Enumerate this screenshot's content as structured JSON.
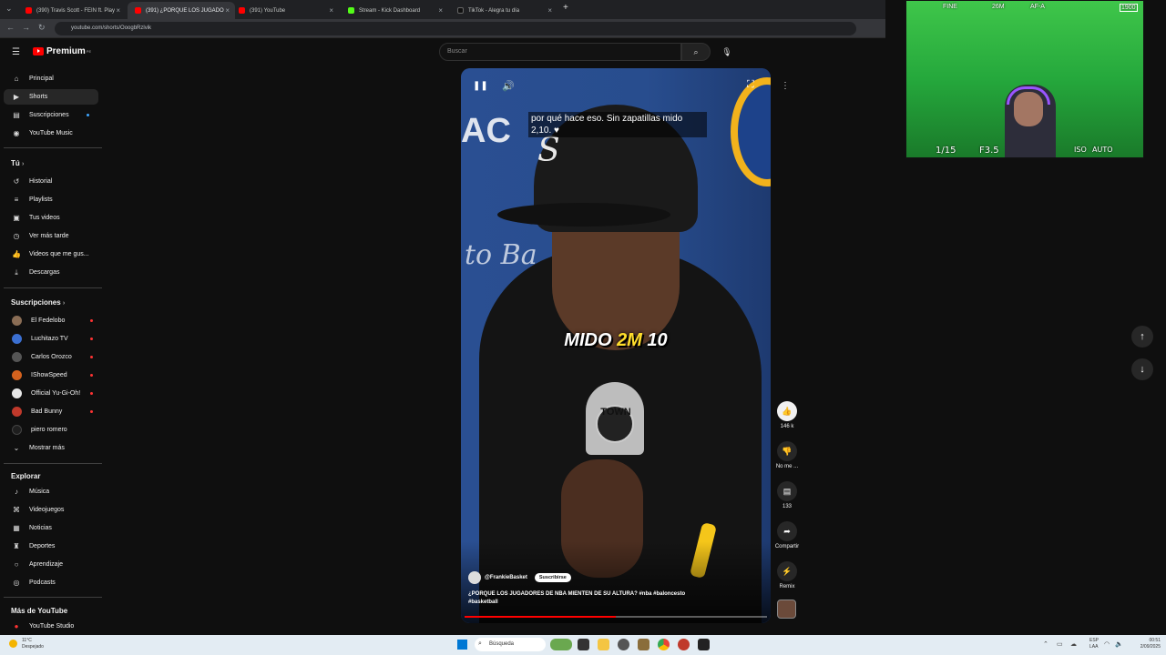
{
  "browser": {
    "tabs": [
      {
        "title": "(390) Travis Scott - FEIN ft. Play",
        "color": "#ff0000"
      },
      {
        "title": "(391) ¿PORQUE LOS JUGADO",
        "color": "#ff0000"
      },
      {
        "title": "(391) YouTube",
        "color": "#ff0000"
      },
      {
        "title": "Stream - Kick Dashboard",
        "color": "#53fc18"
      },
      {
        "title": "TikTok - Alegra tu día",
        "color": "#111111"
      }
    ],
    "url": "youtube.com/shorts/OoogbRzlvik"
  },
  "header": {
    "logo": "Premium",
    "logo_super": "PE",
    "search_placeholder": "Buscar"
  },
  "sidebar": {
    "main": [
      {
        "label": "Principal",
        "icon": "home-icon"
      },
      {
        "label": "Shorts",
        "icon": "shorts-icon"
      },
      {
        "label": "Suscripciones",
        "icon": "subscriptions-icon"
      },
      {
        "label": "YouTube Music",
        "icon": "music-icon"
      }
    ],
    "you_title": "Tú",
    "you": [
      {
        "label": "Historial",
        "icon": "history-icon"
      },
      {
        "label": "Playlists",
        "icon": "playlists-icon"
      },
      {
        "label": "Tus videos",
        "icon": "your-videos-icon"
      },
      {
        "label": "Ver más tarde",
        "icon": "watch-later-icon"
      },
      {
        "label": "Videos que me gus...",
        "icon": "liked-icon"
      },
      {
        "label": "Descargas",
        "icon": "downloads-icon"
      }
    ],
    "subs_title": "Suscripciones",
    "subs": [
      {
        "label": "El Fedelobo",
        "color": "#8a6d55"
      },
      {
        "label": "Luchitazo TV",
        "color": "#3b6fd1"
      },
      {
        "label": "Carlos Orozco",
        "color": "#555555"
      },
      {
        "label": "IShowSpeed",
        "color": "#d4621e"
      },
      {
        "label": "Official Yu-Gi-Oh!",
        "color": "#e8e8e8"
      },
      {
        "label": "Bad Bunny",
        "color": "#c0392b"
      },
      {
        "label": "piero romero",
        "color": "#1f1f1f"
      }
    ],
    "show_more": "Mostrar más",
    "explore_title": "Explorar",
    "explore": [
      {
        "label": "Música",
        "icon": "music-note-icon"
      },
      {
        "label": "Videojuegos",
        "icon": "gaming-icon"
      },
      {
        "label": "Noticias",
        "icon": "news-icon"
      },
      {
        "label": "Deportes",
        "icon": "sports-icon"
      },
      {
        "label": "Aprendizaje",
        "icon": "learning-icon"
      },
      {
        "label": "Podcasts",
        "icon": "podcasts-icon"
      }
    ],
    "more_title": "Más de YouTube",
    "more": [
      {
        "label": "YouTube Studio",
        "icon": "studio-icon"
      }
    ]
  },
  "player": {
    "caption_top": "por qué hace eso. Sin zapatillas mido 2,10. ♥",
    "subtitle_a": "MIDO ",
    "subtitle_b": "2M",
    "subtitle_c": " 10",
    "bg_text1": "AC",
    "bg_text2": "to Ba",
    "mic_label": "TOWN",
    "channel": "@FrankieBasket",
    "subscribe": "Suscribirse",
    "description": "¿PORQUE LOS JUGADORES DE NBA MIENTEN DE SU ALTURA? #nba #baloncesto #basketball",
    "progress": 0.5
  },
  "actions": {
    "likes": "146 k",
    "dislike": "No me ...",
    "comments": "133",
    "share": "Compartir",
    "remix": "Remix"
  },
  "webcam": {
    "top_left": "FINE",
    "top_mid": "26M",
    "top_right": "AF-A",
    "bottom_left": "1/15",
    "bottom_mid": "F3.5",
    "bottom_iso": "ISO",
    "bottom_auto": "AUTO",
    "badge": "1900"
  },
  "taskbar": {
    "weather_temp": "11°C",
    "weather_text": "Despejado",
    "search": "Búsqueda",
    "lang1": "ESP",
    "lang2": "LAA",
    "time": "00:51",
    "date": "2/09/2025"
  }
}
